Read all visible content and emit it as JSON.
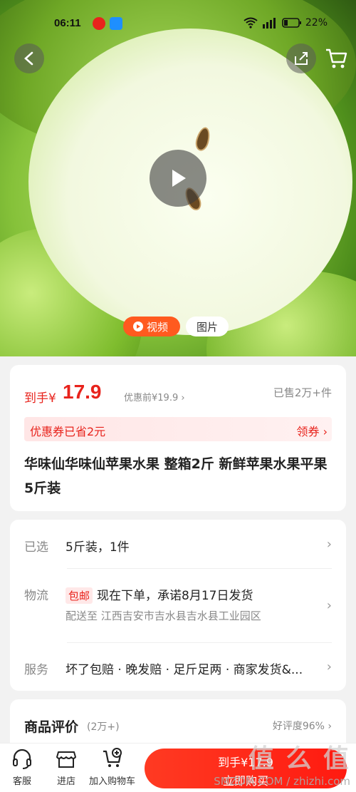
{
  "status_bar": {
    "time": "06:11",
    "battery": "22%"
  },
  "hero": {
    "tabs": [
      {
        "label": "视频",
        "icon": "play-circle-icon",
        "active": true
      },
      {
        "label": "图片",
        "active": false
      }
    ]
  },
  "price": {
    "prefix": "到手¥",
    "value": "17.9",
    "before": "优惠前¥19.9 ›",
    "sold": "已售2万+件"
  },
  "coupon": {
    "text": "优惠券已省2元",
    "action": "领券 ›"
  },
  "product": {
    "title": "华味仙华味仙苹果水果 整箱2斤 新鲜苹果水果平果 5斤装"
  },
  "specs": [
    {
      "label": "已选",
      "value": "5斤装，1件"
    },
    {
      "label": "物流",
      "tag": "包邮",
      "value": "现在下单，承诺8月17日发货",
      "sub": "配送至  江西吉安市吉水县吉水县工业园区"
    },
    {
      "label": "服务",
      "value": "坏了包赔 · 晚发赔 · 足斤足两 · 商家发货&..."
    }
  ],
  "reviews": {
    "title": "商品评价",
    "count": "(2万+)",
    "rate": "好评度96%  ›"
  },
  "bottom_bar": {
    "items": [
      {
        "label": "客服",
        "icon": "headset-icon"
      },
      {
        "label": "进店",
        "icon": "store-icon"
      },
      {
        "label": "加入购物车",
        "icon": "add-cart-icon"
      }
    ],
    "buy": {
      "line1": "到手¥17.9",
      "line2": "立即购买"
    }
  },
  "watermark": {
    "line1": "值 么 值",
    "line2": "SMZDM.COM / zhizhi.com"
  },
  "colors": {
    "accent": "#e8231c",
    "tab_active": "#ff5a1f"
  }
}
